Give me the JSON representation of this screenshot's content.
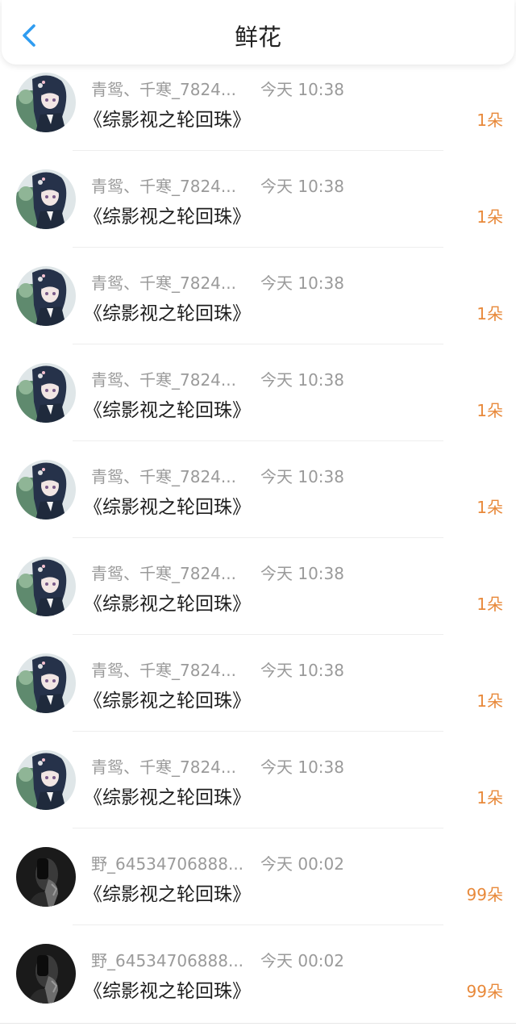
{
  "header": {
    "title": "鲜花",
    "back_icon": "chevron-left-icon",
    "accent_color": "#2f9cf0"
  },
  "colors": {
    "count": "#e8893a",
    "meta": "#9a9a9a"
  },
  "rows": [
    {
      "avatar": "anime-avatar",
      "name": "青鸳、千寒_7824...",
      "time": "今天 10:38",
      "book": "《综影视之轮回珠》",
      "count": "1朵"
    },
    {
      "avatar": "anime-avatar",
      "name": "青鸳、千寒_7824...",
      "time": "今天 10:38",
      "book": "《综影视之轮回珠》",
      "count": "1朵"
    },
    {
      "avatar": "anime-avatar",
      "name": "青鸳、千寒_7824...",
      "time": "今天 10:38",
      "book": "《综影视之轮回珠》",
      "count": "1朵"
    },
    {
      "avatar": "anime-avatar",
      "name": "青鸳、千寒_7824...",
      "time": "今天 10:38",
      "book": "《综影视之轮回珠》",
      "count": "1朵"
    },
    {
      "avatar": "anime-avatar",
      "name": "青鸳、千寒_7824...",
      "time": "今天 10:38",
      "book": "《综影视之轮回珠》",
      "count": "1朵"
    },
    {
      "avatar": "anime-avatar",
      "name": "青鸳、千寒_7824...",
      "time": "今天 10:38",
      "book": "《综影视之轮回珠》",
      "count": "1朵"
    },
    {
      "avatar": "anime-avatar",
      "name": "青鸳、千寒_7824...",
      "time": "今天 10:38",
      "book": "《综影视之轮回珠》",
      "count": "1朵"
    },
    {
      "avatar": "anime-avatar",
      "name": "青鸳、千寒_7824...",
      "time": "今天 10:38",
      "book": "《综影视之轮回珠》",
      "count": "1朵"
    },
    {
      "avatar": "dark-photo-avatar",
      "name": "野_64534706888...",
      "time": "今天 00:02",
      "book": "《综影视之轮回珠》",
      "count": "99朵"
    },
    {
      "avatar": "dark-photo-avatar",
      "name": "野_64534706888...",
      "time": "今天 00:02",
      "book": "《综影视之轮回珠》",
      "count": "99朵"
    }
  ]
}
